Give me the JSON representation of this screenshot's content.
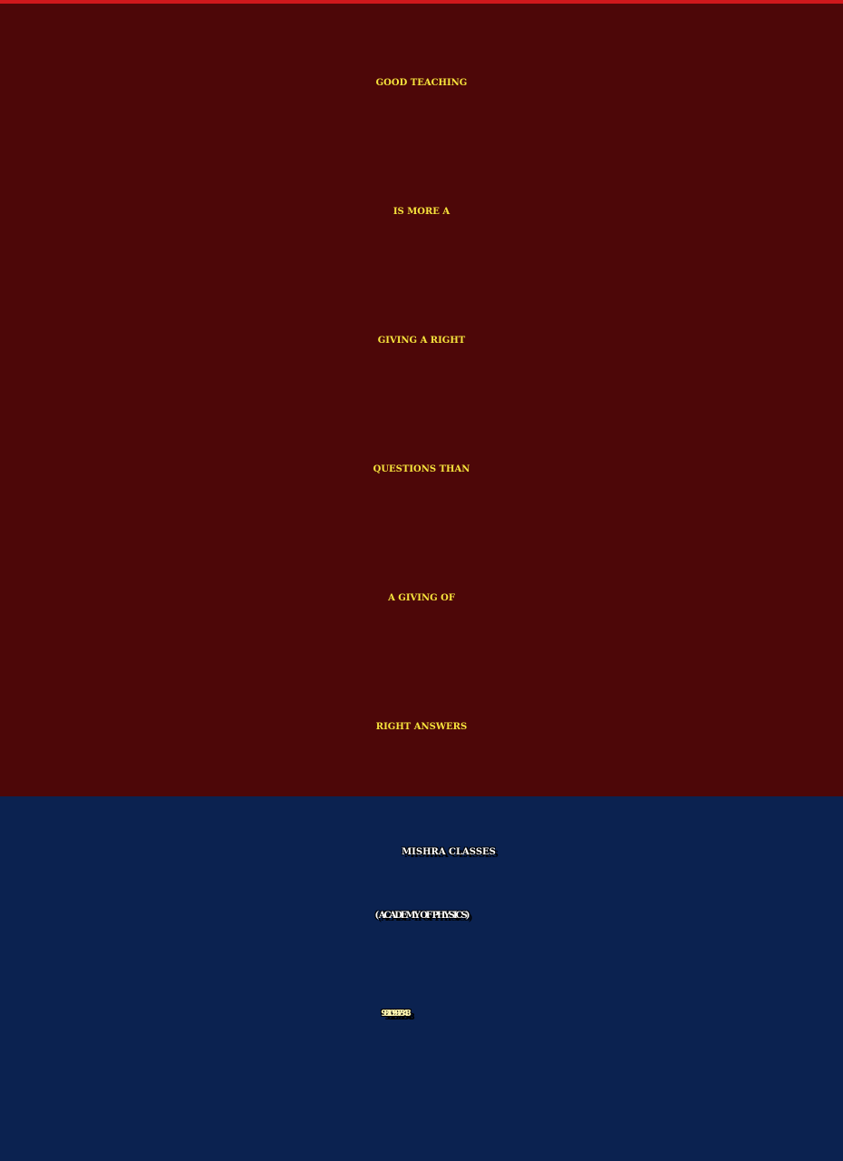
{
  "colors": {
    "top_rule": "#d0181c",
    "quote_background": "#4d0708",
    "quote_text": "#f6e33c",
    "brand_background": "#0b2250",
    "brand_text": "#ffffff",
    "phone_text": "#fdf5b0"
  },
  "quote": {
    "lines": [
      "GOOD TEACHING",
      "IS MORE A",
      "GIVING A RIGHT",
      "QUESTIONS THAN",
      "A GIVING OF",
      "RIGHT ANSWERS"
    ]
  },
  "brand": {
    "name": "MISHRA CLASSES",
    "subtitle": "( ACADEMY OF PHYSICS)",
    "phone": "9810997348"
  }
}
